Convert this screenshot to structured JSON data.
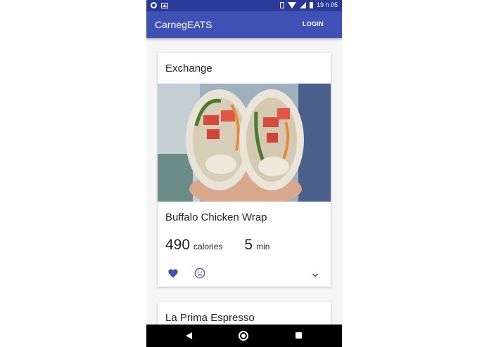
{
  "status_bar": {
    "time": "19 h 05"
  },
  "app_bar": {
    "title": "CarnegEATS",
    "login_label": "LOGIN"
  },
  "cards": [
    {
      "location": "Exchange",
      "dish": "Buffalo Chicken Wrap",
      "calories": "490",
      "calories_unit": "calories",
      "time": "5",
      "time_unit": "min",
      "icons": {
        "like": "heart-icon",
        "dislike": "sad-face-icon",
        "expand": "chevron-down-icon"
      }
    },
    {
      "location": "La Prima Espresso"
    }
  ],
  "colors": {
    "primary": "#3f51b5",
    "status_bar": "#2b3a99",
    "icon_accent": "#3f51b5"
  }
}
